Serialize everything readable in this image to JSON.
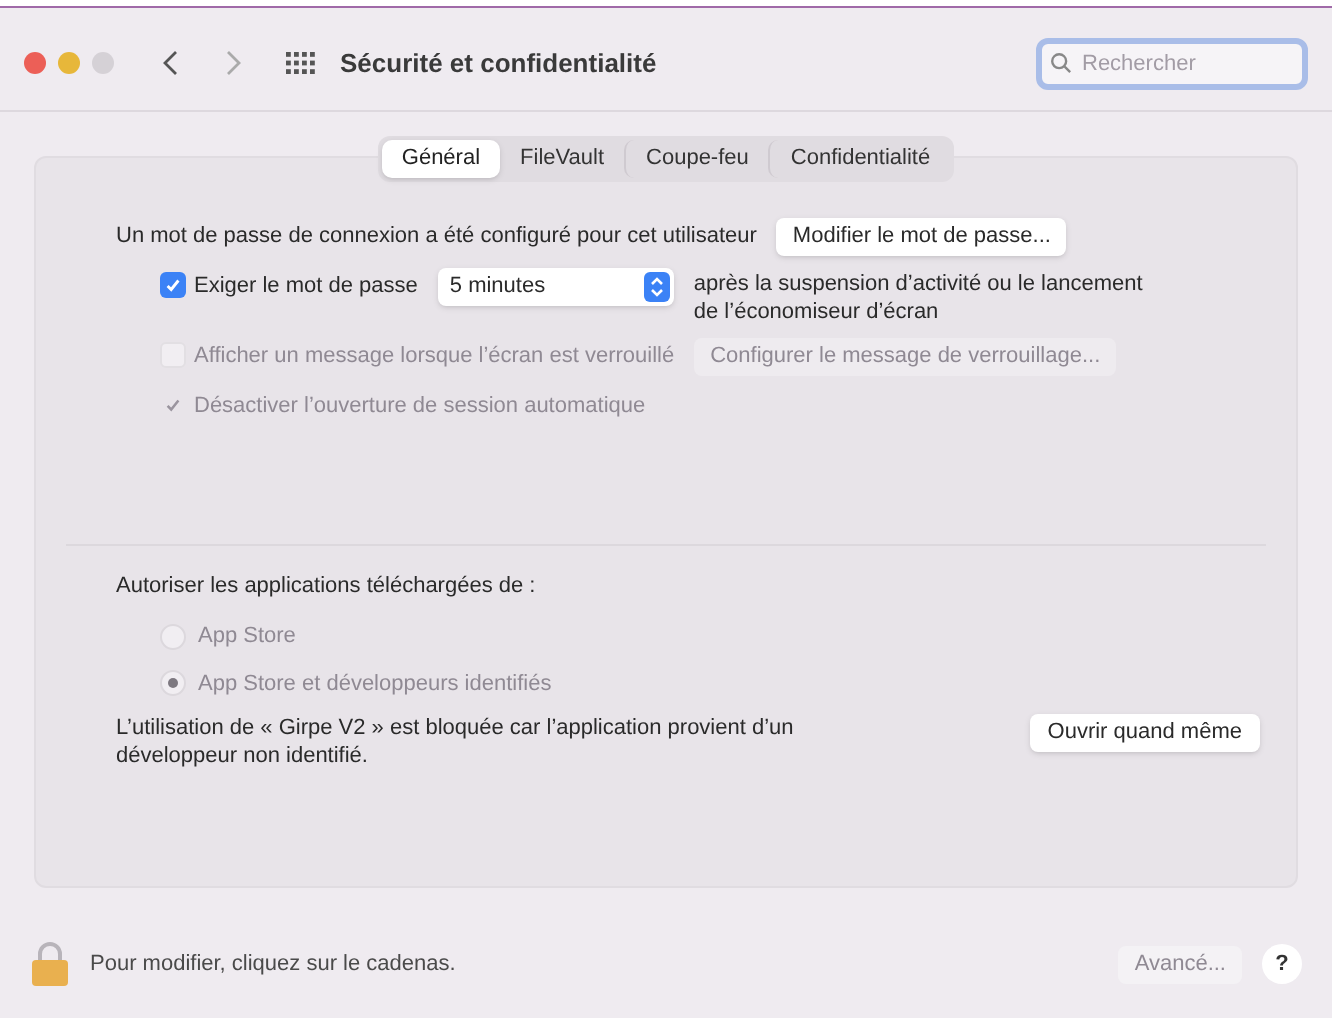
{
  "window": {
    "title": "Sécurité et confidentialité"
  },
  "search": {
    "placeholder": "Rechercher"
  },
  "tabs": [
    {
      "label": "Général",
      "selected": true
    },
    {
      "label": "FileVault",
      "selected": false
    },
    {
      "label": "Coupe-feu",
      "selected": false
    },
    {
      "label": "Confidentialité",
      "selected": false
    }
  ],
  "password": {
    "text": "Un mot de passe de connexion a été configuré pour cet utilisateur",
    "button": "Modifier le mot de passe..."
  },
  "options": [
    {
      "kind": "require",
      "label": "Exiger le mot de passe",
      "checked": true,
      "disabled": false,
      "value": "5 minutes",
      "suffix": "après la suspension d’activité ou le lancement de l’économiseur d’écran"
    },
    {
      "kind": "message",
      "label": "Afficher un message lorsque l’écran est verrouillé",
      "checked": false,
      "disabled": true,
      "button": "Configurer le message de verrouillage..."
    },
    {
      "kind": "tick",
      "label": "Désactiver l’ouverture de session automatique",
      "checked": true,
      "disabled": true
    }
  ],
  "downloads": {
    "title": "Autoriser les applications téléchargées de :",
    "radios": [
      {
        "label": "App Store",
        "selected": false,
        "disabled": true
      },
      {
        "label": "App Store et développeurs identifiés",
        "selected": true,
        "disabled": true
      }
    ],
    "blocked": "L’utilisation de « Girpe V2 » est bloquée car l’application provient d’un développeur non identifié.",
    "button": "Ouvrir quand même"
  },
  "footer": {
    "lock_text": "Pour modifier, cliquez sur le cadenas.",
    "advanced": {
      "label": "Avancé...",
      "disabled": true
    },
    "help": "?"
  }
}
